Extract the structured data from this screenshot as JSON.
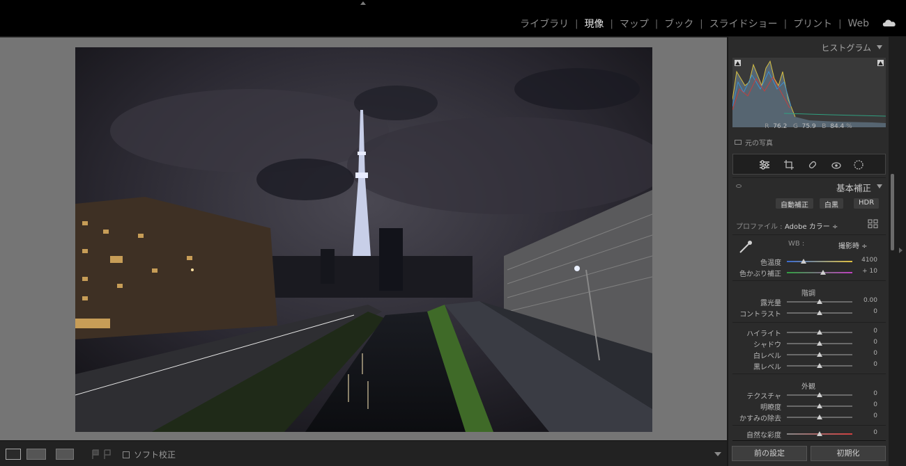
{
  "modules": [
    {
      "label": "ライブラリ",
      "active": false
    },
    {
      "label": "現像",
      "active": true
    },
    {
      "label": "マップ",
      "active": false
    },
    {
      "label": "ブック",
      "active": false
    },
    {
      "label": "スライドショー",
      "active": false
    },
    {
      "label": "プリント",
      "active": false
    },
    {
      "label": "Web",
      "active": false
    }
  ],
  "histogram": {
    "title": "ヒストグラム",
    "r_label": "R",
    "r_value": "76.2",
    "g_label": "G",
    "g_value": "75.9",
    "b_label": "B",
    "b_value": "84.4",
    "percent": "%",
    "original_photo": "元の写真"
  },
  "basic": {
    "title": "基本補正",
    "auto": "自動補正",
    "bw": "白黒",
    "hdr": "HDR",
    "profile_label": "プロファイル :",
    "profile_value": "Adobe カラー ÷",
    "wb_label": "WB :",
    "wb_value": "撮影時 ÷",
    "tone_section": "階調",
    "presence_section": "外観",
    "rows": [
      {
        "label": "色温度",
        "value": "4100",
        "pos": 0.25,
        "track": "temp"
      },
      {
        "label": "色かぶり補正",
        "value": "+ 10",
        "pos": 0.55,
        "track": "tint"
      },
      {
        "label": "露光量",
        "value": "0.00",
        "pos": 0.5,
        "track": "gray"
      },
      {
        "label": "コントラスト",
        "value": "0",
        "pos": 0.5,
        "track": "gray"
      },
      {
        "label": "ハイライト",
        "value": "0",
        "pos": 0.5,
        "track": "gray"
      },
      {
        "label": "シャドウ",
        "value": "0",
        "pos": 0.5,
        "track": "gray"
      },
      {
        "label": "白レベル",
        "value": "0",
        "pos": 0.5,
        "track": "gray"
      },
      {
        "label": "黒レベル",
        "value": "0",
        "pos": 0.5,
        "track": "gray"
      },
      {
        "label": "テクスチャ",
        "value": "0",
        "pos": 0.5,
        "track": "gray"
      },
      {
        "label": "明瞭度",
        "value": "0",
        "pos": 0.5,
        "track": "gray"
      },
      {
        "label": "かすみの除去",
        "value": "0",
        "pos": 0.5,
        "track": "gray"
      },
      {
        "label": "自然な彩度",
        "value": "0",
        "pos": 0.5,
        "track": "vib"
      }
    ]
  },
  "buttons": {
    "previous": "前の設定",
    "reset": "初期化"
  },
  "toolbar": {
    "soft_proof": "ソフト校正"
  }
}
